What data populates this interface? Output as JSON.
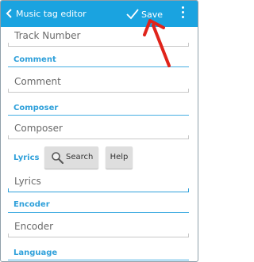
{
  "appbar": {
    "title": "Music tag editor",
    "save_label": "Save"
  },
  "fields": {
    "track_number": {
      "placeholder": "Track Number"
    },
    "comment": {
      "label": "Comment",
      "placeholder": "Comment"
    },
    "composer": {
      "label": "Composer",
      "placeholder": "Composer"
    },
    "lyrics": {
      "label": "Lyrics",
      "placeholder": "Lyrics"
    },
    "encoder": {
      "label": "Encoder",
      "placeholder": "Encoder"
    },
    "language": {
      "label": "Language"
    }
  },
  "buttons": {
    "search_label": "Search",
    "help_label": "Help"
  },
  "colors": {
    "accent": "#1aa3e0",
    "section_label": "#2fa0da",
    "annotation_arrow": "#e0241b"
  },
  "icons": {
    "back": "chevron-left-icon",
    "save": "check-icon",
    "overflow": "overflow-menu-icon",
    "search": "magnifier-icon"
  }
}
